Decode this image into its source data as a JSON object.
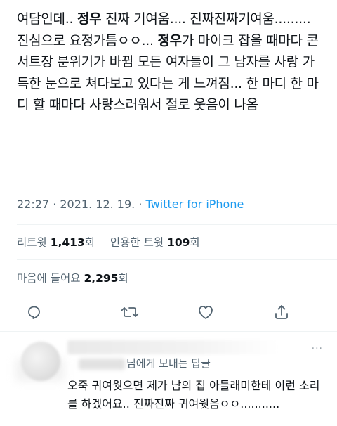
{
  "tweet": {
    "segments": [
      {
        "text": "여담인데.. ",
        "bold": false
      },
      {
        "text": "정우",
        "bold": true
      },
      {
        "text": " 진짜 기여움.... 진짜진짜기여움......... 진심으로 요정가틈ㅇㅇ... ",
        "bold": false
      },
      {
        "text": "정우",
        "bold": true
      },
      {
        "text": "가 마이크 잡을 때마다 콘서트장 분위기가 바뀜 모든 여자들이 그 남자를 사랑 가득한 눈으로 쳐다보고 있다는 게 느껴짐... 한 마디 한 마디 할 때마다 사랑스러워서 절로 웃음이 나옴",
        "bold": false
      }
    ],
    "time": "22:27",
    "date": "2021. 12. 19.",
    "separator": " · ",
    "source": "Twitter for iPhone"
  },
  "stats": {
    "retweets_label": "리트윗",
    "retweets": "1,413",
    "retweets_unit": "회",
    "quotes_label": "인용한 트윗",
    "quotes": "109",
    "quotes_unit": "회",
    "likes_label": "마음에 들어요",
    "likes": "2,295",
    "likes_unit": "회"
  },
  "actions": {
    "reply_icon": "reply-icon",
    "retweet_icon": "retweet-icon",
    "like_icon": "heart-icon",
    "share_icon": "share-icon"
  },
  "reply": {
    "more": "···",
    "reply_to": "님에게 보내는 답글",
    "text": "오죽 귀여웟으면 제가 남의 집 아들래미한테 이런 소리를 하겠어요.. 진짜진짜 귀여웟음ㅇㅇ..........."
  },
  "colors": {
    "text": "#0f1419",
    "secondary": "#536471",
    "link": "#1d9bf0",
    "divider": "#eff3f4"
  }
}
